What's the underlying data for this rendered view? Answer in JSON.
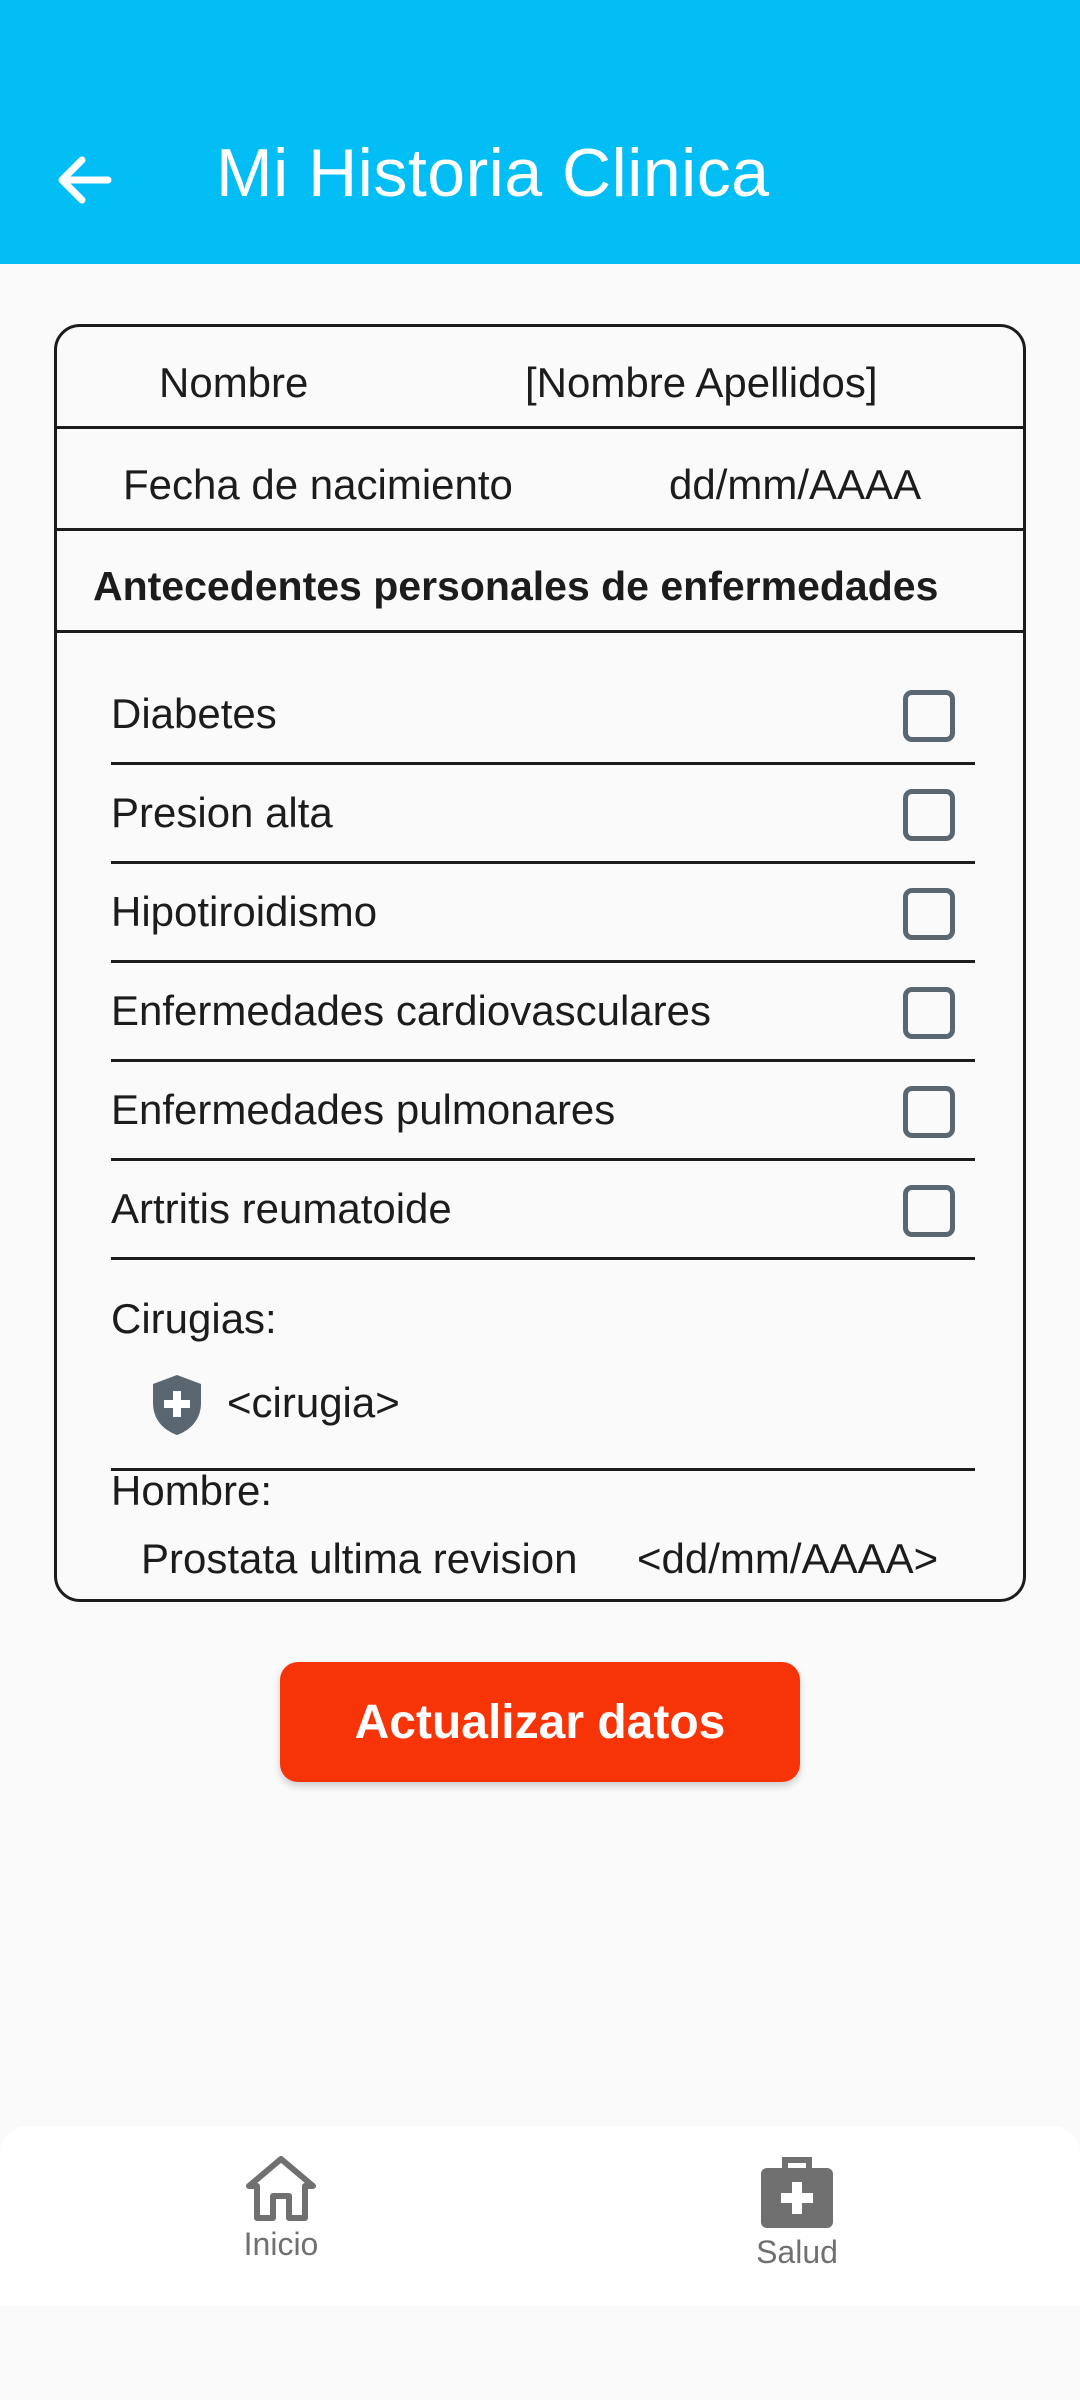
{
  "appbar": {
    "title": "Mi Historia Clinica"
  },
  "patient": {
    "name_label": "Nombre",
    "name_value": "[Nombre Apellidos]",
    "birth_label": "Fecha de nacimiento",
    "birth_value": "dd/mm/AAAA"
  },
  "section_title": "Antecedentes personales de enfermedades",
  "conditions": [
    {
      "label": "Diabetes",
      "checked": false
    },
    {
      "label": "Presion alta",
      "checked": false
    },
    {
      "label": "Hipotiroidismo",
      "checked": false
    },
    {
      "label": "Enfermedades cardiovasculares",
      "checked": false
    },
    {
      "label": "Enfermedades pulmonares",
      "checked": false
    },
    {
      "label": "Artritis reumatoide",
      "checked": false
    }
  ],
  "surgeries": {
    "label": "Cirugias:",
    "item": "<cirugia>"
  },
  "man": {
    "label": "Hombre:",
    "prostate_label": "Prostata ultima revision",
    "prostate_value": "<dd/mm/AAAA>"
  },
  "update_button": "Actualizar datos",
  "bottom_nav": {
    "home_label": "Inicio",
    "health_label": "Salud"
  },
  "colors": {
    "appbar": "#03bdf5",
    "button": "#f73408",
    "icon_gray": "#5a6670"
  },
  "icons": {
    "back": "arrow-left-icon",
    "surgery": "shield-plus-icon",
    "home": "home-icon",
    "health": "medical-bag-icon"
  }
}
